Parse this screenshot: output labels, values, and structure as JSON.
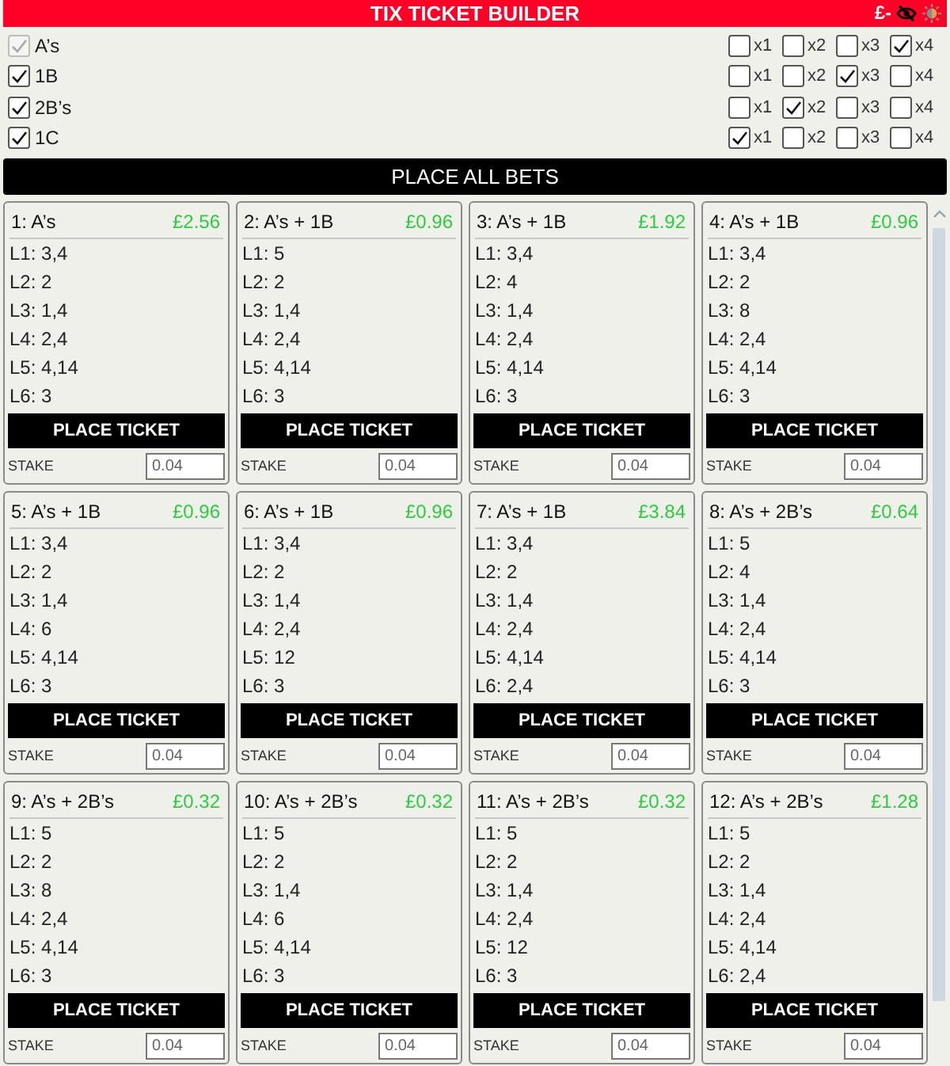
{
  "header": {
    "title": "TIX TICKET BUILDER",
    "balance": "£-"
  },
  "legs": [
    {
      "label": "A’s",
      "checked": true,
      "disabled": true,
      "multipliers": [
        {
          "label": "x1",
          "checked": false
        },
        {
          "label": "x2",
          "checked": false
        },
        {
          "label": "x3",
          "checked": false
        },
        {
          "label": "x4",
          "checked": true
        }
      ]
    },
    {
      "label": "1B",
      "checked": true,
      "disabled": false,
      "multipliers": [
        {
          "label": "x1",
          "checked": false
        },
        {
          "label": "x2",
          "checked": false
        },
        {
          "label": "x3",
          "checked": true
        },
        {
          "label": "x4",
          "checked": false
        }
      ]
    },
    {
      "label": "2B’s",
      "checked": true,
      "disabled": false,
      "multipliers": [
        {
          "label": "x1",
          "checked": false
        },
        {
          "label": "x2",
          "checked": true
        },
        {
          "label": "x3",
          "checked": false
        },
        {
          "label": "x4",
          "checked": false
        }
      ]
    },
    {
      "label": "1C",
      "checked": true,
      "disabled": false,
      "multipliers": [
        {
          "label": "x1",
          "checked": true
        },
        {
          "label": "x2",
          "checked": false
        },
        {
          "label": "x3",
          "checked": false
        },
        {
          "label": "x4",
          "checked": false
        }
      ]
    }
  ],
  "place_all_button": "PLACE ALL BETS",
  "tickets": [
    {
      "title": "1: A’s",
      "price": "£2.56",
      "lines": [
        "L1: 3,4",
        "L2: 2",
        "L3: 1,4",
        "L4: 2,4",
        "L5: 4,14",
        "L6: 3"
      ],
      "button": "PLACE TICKET",
      "stake": {
        "label": "STAKE",
        "value": "0.04"
      }
    },
    {
      "title": "2: A’s + 1B",
      "price": "£0.96",
      "lines": [
        "L1: 5",
        "L2: 2",
        "L3: 1,4",
        "L4: 2,4",
        "L5: 4,14",
        "L6: 3"
      ],
      "button": "PLACE TICKET",
      "stake": {
        "label": "STAKE",
        "value": "0.04"
      }
    },
    {
      "title": "3: A’s + 1B",
      "price": "£1.92",
      "lines": [
        "L1: 3,4",
        "L2: 4",
        "L3: 1,4",
        "L4: 2,4",
        "L5: 4,14",
        "L6: 3"
      ],
      "button": "PLACE TICKET",
      "stake": {
        "label": "STAKE",
        "value": "0.04"
      }
    },
    {
      "title": "4: A’s + 1B",
      "price": "£0.96",
      "lines": [
        "L1: 3,4",
        "L2: 2",
        "L3: 8",
        "L4: 2,4",
        "L5: 4,14",
        "L6: 3"
      ],
      "button": "PLACE TICKET",
      "stake": {
        "label": "STAKE",
        "value": "0.04"
      }
    },
    {
      "title": "5: A’s + 1B",
      "price": "£0.96",
      "lines": [
        "L1: 3,4",
        "L2: 2",
        "L3: 1,4",
        "L4: 6",
        "L5: 4,14",
        "L6: 3"
      ],
      "button": "PLACE TICKET",
      "stake": {
        "label": "STAKE",
        "value": "0.04"
      }
    },
    {
      "title": "6: A’s + 1B",
      "price": "£0.96",
      "lines": [
        "L1: 3,4",
        "L2: 2",
        "L3: 1,4",
        "L4: 2,4",
        "L5: 12",
        "L6: 3"
      ],
      "button": "PLACE TICKET",
      "stake": {
        "label": "STAKE",
        "value": "0.04"
      }
    },
    {
      "title": "7: A’s + 1B",
      "price": "£3.84",
      "lines": [
        "L1: 3,4",
        "L2: 2",
        "L3: 1,4",
        "L4: 2,4",
        "L5: 4,14",
        "L6: 2,4"
      ],
      "button": "PLACE TICKET",
      "stake": {
        "label": "STAKE",
        "value": "0.04"
      }
    },
    {
      "title": "8: A’s + 2B’s",
      "price": "£0.64",
      "lines": [
        "L1: 5",
        "L2: 4",
        "L3: 1,4",
        "L4: 2,4",
        "L5: 4,14",
        "L6: 3"
      ],
      "button": "PLACE TICKET",
      "stake": {
        "label": "STAKE",
        "value": "0.04"
      }
    },
    {
      "title": "9: A’s + 2B’s",
      "price": "£0.32",
      "lines": [
        "L1: 5",
        "L2: 2",
        "L3: 8",
        "L4: 2,4",
        "L5: 4,14",
        "L6: 3"
      ],
      "button": "PLACE TICKET",
      "stake": {
        "label": "STAKE",
        "value": "0.04"
      }
    },
    {
      "title": "10: A’s + 2B’s",
      "price": "£0.32",
      "lines": [
        "L1: 5",
        "L2: 2",
        "L3: 1,4",
        "L4: 6",
        "L5: 4,14",
        "L6: 3"
      ],
      "button": "PLACE TICKET",
      "stake": {
        "label": "STAKE",
        "value": "0.04"
      }
    },
    {
      "title": "11: A’s + 2B’s",
      "price": "£0.32",
      "lines": [
        "L1: 5",
        "L2: 2",
        "L3: 1,4",
        "L4: 2,4",
        "L5: 12",
        "L6: 3"
      ],
      "button": "PLACE TICKET",
      "stake": {
        "label": "STAKE",
        "value": "0.04"
      }
    },
    {
      "title": "12: A’s + 2B’s",
      "price": "£1.28",
      "lines": [
        "L1: 5",
        "L2: 2",
        "L3: 1,4",
        "L4: 2,4",
        "L5: 4,14",
        "L6: 2,4"
      ],
      "button": "PLACE TICKET",
      "stake": {
        "label": "STAKE",
        "value": "0.04"
      }
    }
  ]
}
